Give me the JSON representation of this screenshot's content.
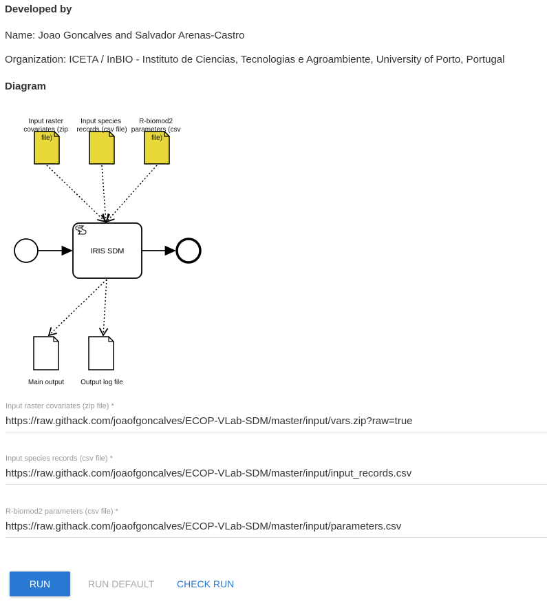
{
  "developed_by": {
    "heading": "Developed by",
    "name_line": "Name: Joao Goncalves and Salvador Arenas-Castro",
    "organization_line": "Organization: ICETA / InBIO - Instituto de Ciencias, Tecnologias e Agroambiente, University of Porto, Portugal"
  },
  "diagram": {
    "heading": "Diagram",
    "inputs": [
      {
        "label_lines": [
          "Input raster",
          "covariates (zip",
          "file)"
        ]
      },
      {
        "label_lines": [
          "Input species",
          "records (csv file)"
        ]
      },
      {
        "label_lines": [
          "R-biomod2",
          "parameters (csv",
          "file)"
        ]
      }
    ],
    "task_label": "IRIS SDM",
    "outputs": [
      {
        "label": "Main output"
      },
      {
        "label": "Output log file"
      }
    ],
    "input_doc_color": "#e8d83a"
  },
  "form": {
    "fields": [
      {
        "label": "Input raster covariates (zip file) *",
        "value": "https://raw.githack.com/joaofgoncalves/ECOP-VLab-SDM/master/input/vars.zip?raw=true"
      },
      {
        "label": "Input species records (csv file) *",
        "value": "https://raw.githack.com/joaofgoncalves/ECOP-VLab-SDM/master/input/input_records.csv"
      },
      {
        "label": "R-biomod2 parameters (csv file) *",
        "value": "https://raw.githack.com/joaofgoncalves/ECOP-VLab-SDM/master/input/parameters.csv"
      }
    ]
  },
  "actions": {
    "run_label": "RUN",
    "run_default_label": "RUN DEFAULT",
    "check_run_label": "CHECK RUN",
    "accent_color": "#2979d2",
    "disabled_color": "#a8a8a8"
  }
}
